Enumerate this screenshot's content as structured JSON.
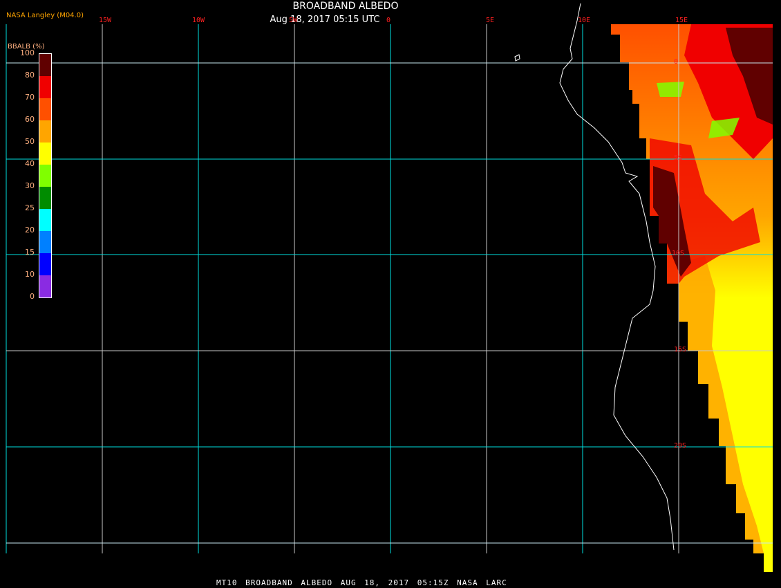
{
  "header": {
    "title": "BROADBAND ALBEDO",
    "subtitle": "Aug 18, 2017 05:15 UTC",
    "credit": "NASA Langley (M04.0)"
  },
  "footer": "MT10  BROADBAND ALBEDO   AUG 18, 2017 05:15Z   NASA LARC",
  "longitude_labels": [
    "15W",
    "10W",
    "5W",
    "0",
    "5E",
    "10E",
    "15E"
  ],
  "latitude_labels": [
    "0",
    "5S",
    "10S",
    "15S",
    "20S"
  ],
  "legend": {
    "title": "BBALB (%)",
    "levels": [
      "100",
      "80",
      "70",
      "60",
      "50",
      "40",
      "30",
      "25",
      "20",
      "15",
      "10",
      "0"
    ],
    "colors": [
      "#600000",
      "#f00000",
      "#ff5000",
      "#ffa500",
      "#ffff00",
      "#80ff00",
      "#008c00",
      "#00ffff",
      "#0080ff",
      "#0000ff",
      "#8a2be2"
    ]
  }
}
